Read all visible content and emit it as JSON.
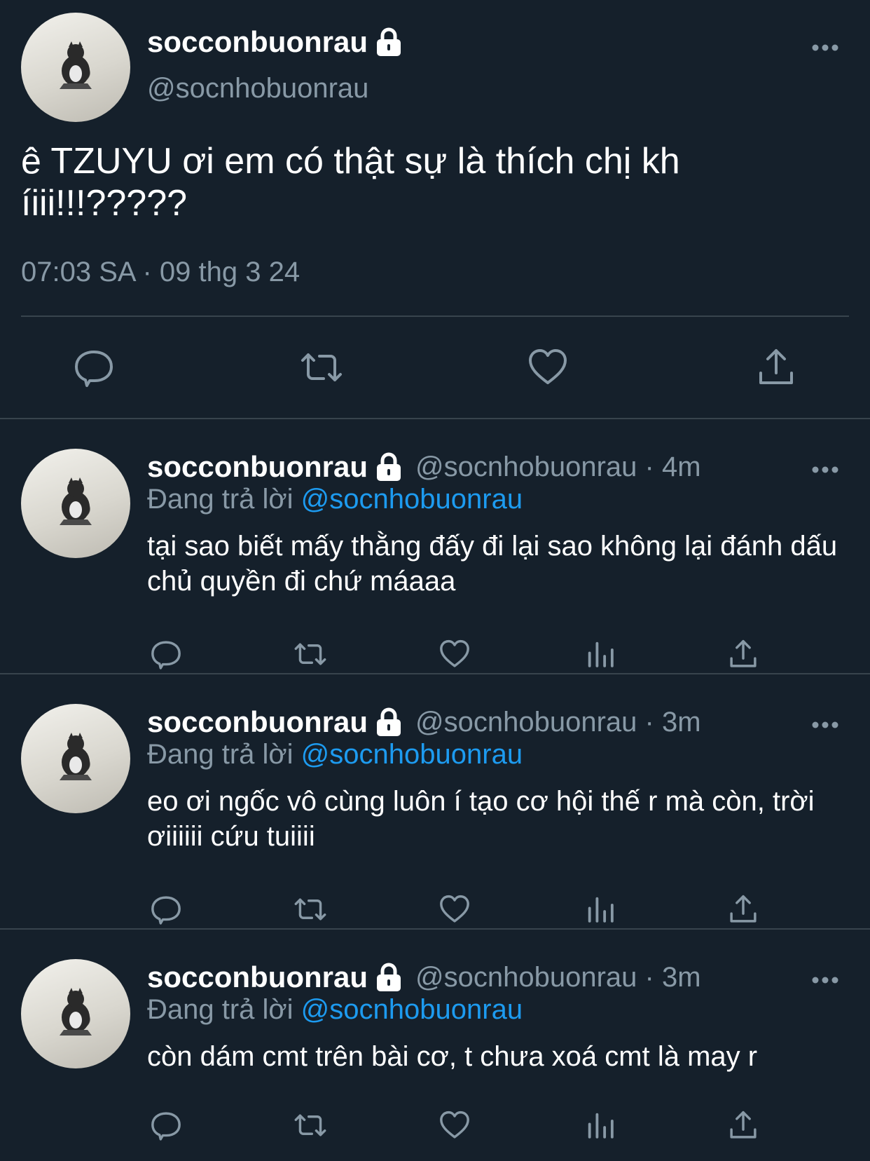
{
  "main_tweet": {
    "display_name": "socconbuonrau",
    "handle": "@socnhobuonrau",
    "text_line1": "ê TZUYU ơi em có thật sự là thích chị kh",
    "text_line2": "íiii!!!?????",
    "timestamp": "07:03 SA · 09 thg 3 24",
    "actions": [
      "reply-icon",
      "retweet-icon",
      "like-icon",
      "share-icon"
    ]
  },
  "replies": [
    {
      "display_name": "socconbuonrau",
      "meta": "@socnhobuonrau · 4m",
      "replying_label": "Đang trả lời",
      "replying_to": "@socnhobuonrau",
      "text": "tại sao biết mấy thằng đấy đi lại sao không lại đánh dấu chủ quyền đi chứ máaaa"
    },
    {
      "display_name": "socconbuonrau",
      "meta": "@socnhobuonrau · 3m",
      "replying_label": "Đang trả lời",
      "replying_to": "@socnhobuonrau",
      "text": "eo ơi ngốc vô cùng luôn í tạo cơ hội thế r mà còn, trời ơiiiiii cứu tuiiii"
    },
    {
      "display_name": "socconbuonrau",
      "meta": "@socnhobuonrau · 3m",
      "replying_label": "Đang trả lời",
      "replying_to": "@socnhobuonrau",
      "text": "còn dám cmt trên bài cơ, t chưa xoá cmt là may r"
    }
  ],
  "colors": {
    "background": "#15202b",
    "secondary_text": "#8899a6",
    "link": "#1d9bf0",
    "divider": "#38444d"
  }
}
